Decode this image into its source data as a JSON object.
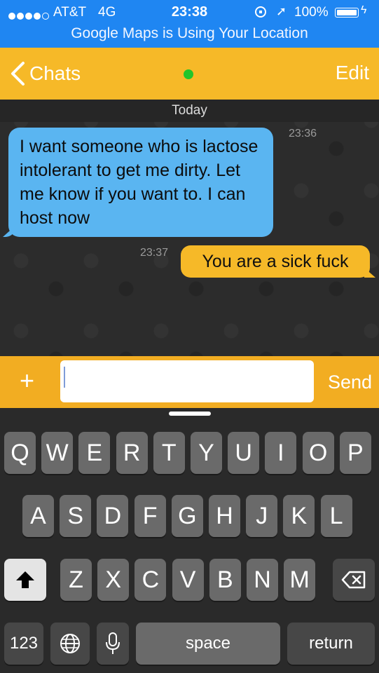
{
  "status_bar": {
    "carrier": "AT&T",
    "network": "4G",
    "time": "23:38",
    "battery_percent": "100%",
    "battery_level": 1.0,
    "location_banner": "Google Maps is Using Your Location"
  },
  "nav": {
    "back_label": "Chats",
    "edit_label": "Edit",
    "online_status_color": "#22c52a"
  },
  "chat": {
    "date_label": "Today",
    "messages": [
      {
        "direction": "incoming",
        "text": "I want someone who is lactose intolerant to get me dirty. Let me know if you want to. I can host now",
        "time": "23:36"
      },
      {
        "direction": "outgoing",
        "text": "You are a sick fuck",
        "time": "23:37"
      }
    ]
  },
  "composer": {
    "plus_label": "+",
    "input_value": "",
    "send_label": "Send"
  },
  "keyboard": {
    "row1": [
      "Q",
      "W",
      "E",
      "R",
      "T",
      "Y",
      "U",
      "I",
      "O",
      "P"
    ],
    "row2": [
      "A",
      "S",
      "D",
      "F",
      "G",
      "H",
      "J",
      "K",
      "L"
    ],
    "row3": [
      "Z",
      "X",
      "C",
      "V",
      "B",
      "N",
      "M"
    ],
    "numbers_label": "123",
    "space_label": "space",
    "return_label": "return"
  },
  "colors": {
    "status_blue": "#1f86f2",
    "accent_yellow": "#f6b928",
    "incoming_bubble": "#5ab5f1"
  }
}
